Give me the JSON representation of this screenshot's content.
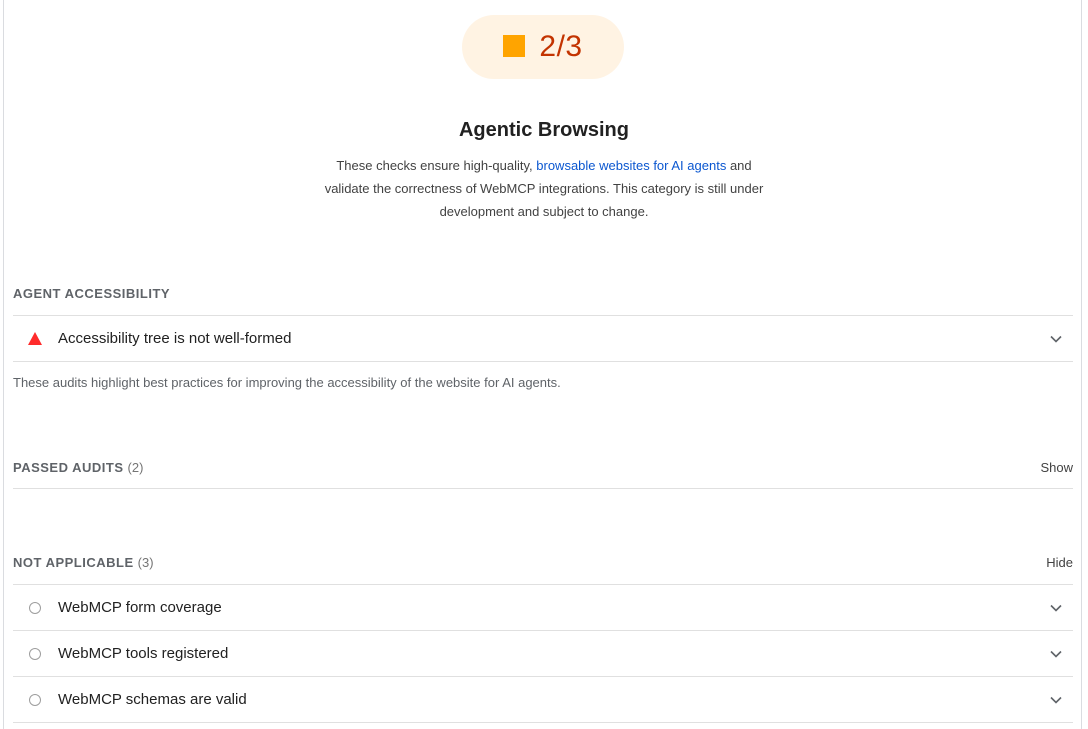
{
  "gauge": {
    "score_text": "2/3",
    "score_color": "#c33300",
    "fill_color": "#ffa400",
    "background_color": "#fff3e3"
  },
  "category": {
    "title": "Agentic Browsing",
    "description_before": "These checks ensure high-quality, ",
    "description_link": "browsable websites for AI agents",
    "description_after": " and validate the correctness of WebMCP integrations. This category is still under development and subject to change."
  },
  "groups": {
    "agent_accessibility": {
      "title": "AGENT ACCESSIBILITY",
      "audits": [
        {
          "title": "Accessibility tree is not well-formed",
          "status": "fail",
          "icon": "warning-triangle-icon"
        }
      ],
      "description": "These audits highlight best practices for improving the accessibility of the website for AI agents."
    },
    "passed": {
      "title": "PASSED AUDITS",
      "count": "(2)",
      "toggle": "Show"
    },
    "not_applicable": {
      "title": "NOT APPLICABLE",
      "count": "(3)",
      "toggle": "Hide",
      "audits": [
        {
          "title": "WebMCP form coverage",
          "icon": "circle-icon"
        },
        {
          "title": "WebMCP tools registered",
          "icon": "circle-icon"
        },
        {
          "title": "WebMCP schemas are valid",
          "icon": "circle-icon"
        }
      ]
    }
  },
  "colors": {
    "fail": "#ff2b2b",
    "link": "#0b57d0",
    "divider": "#e0e0e0"
  }
}
